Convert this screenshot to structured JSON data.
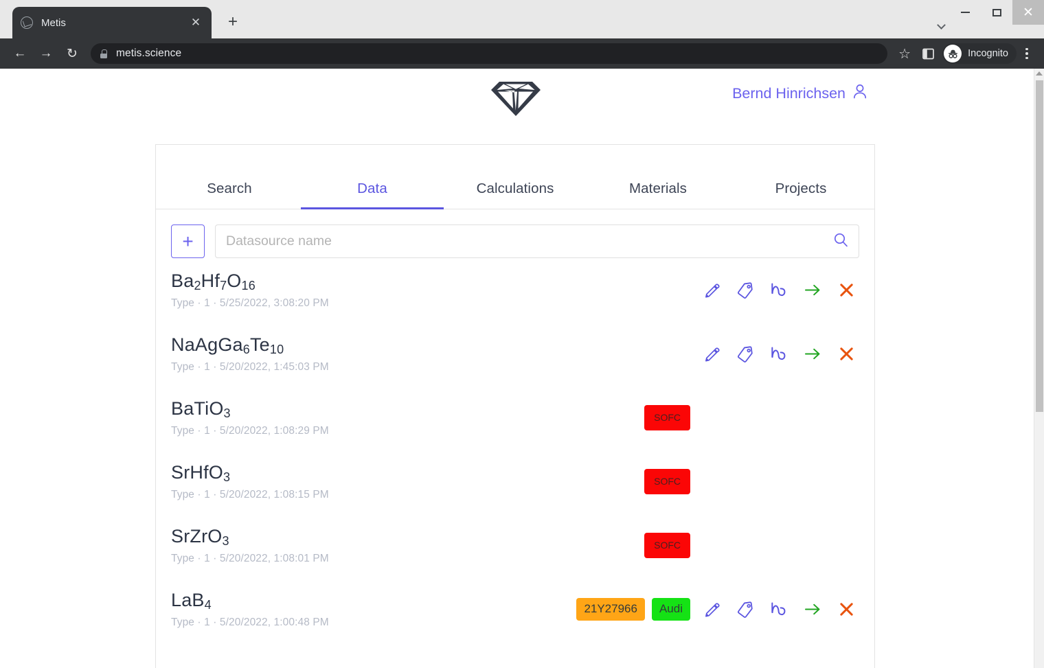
{
  "browser": {
    "tab_title": "Metis",
    "tab_close_glyph": "✕",
    "newtab_glyph": "+",
    "back_glyph": "←",
    "forward_glyph": "→",
    "reload_glyph": "↻",
    "url": "metis.science",
    "star_glyph": "☆",
    "incognito_label": "Incognito",
    "window_close_glyph": "✕"
  },
  "header": {
    "logo_name": "diamond-logo",
    "user_name": "Bernd Hinrichsen"
  },
  "tabs": [
    {
      "label": "Search",
      "active": false
    },
    {
      "label": "Data",
      "active": true
    },
    {
      "label": "Calculations",
      "active": false
    },
    {
      "label": "Materials",
      "active": false
    },
    {
      "label": "Projects",
      "active": false
    }
  ],
  "toolbar": {
    "add_label": "+",
    "search_placeholder": "Datasource name",
    "search_value": ""
  },
  "colors": {
    "accent": "#5b55e0",
    "user_link": "#6b62ee",
    "icon_edit": "#5b55e0",
    "icon_tag": "#5b55e0",
    "icon_plot": "#5b55e0",
    "icon_arrow": "#22a522",
    "icon_delete": "#e8530e",
    "tag_red": "#fb0606",
    "tag_orange": "#ffa516",
    "tag_green": "#15e215"
  },
  "rows": [
    {
      "formula_parts": [
        {
          "t": "Ba",
          "sub": false
        },
        {
          "t": "2",
          "sub": true
        },
        {
          "t": "Hf",
          "sub": false
        },
        {
          "t": "7",
          "sub": true
        },
        {
          "t": "O",
          "sub": false
        },
        {
          "t": "16",
          "sub": true
        }
      ],
      "formula_text": "Ba2Hf7O16",
      "meta": "Type · 1 · 5/25/2022, 3:08:20 PM",
      "tags": [],
      "actions": [
        "edit",
        "tag",
        "plot",
        "move",
        "delete"
      ]
    },
    {
      "formula_parts": [
        {
          "t": "NaAgGa",
          "sub": false
        },
        {
          "t": "6",
          "sub": true
        },
        {
          "t": "Te",
          "sub": false
        },
        {
          "t": "10",
          "sub": true
        }
      ],
      "formula_text": "NaAgGa6Te10",
      "meta": "Type · 1 · 5/20/2022, 1:45:03 PM",
      "tags": [],
      "actions": [
        "edit",
        "tag",
        "plot",
        "move",
        "delete"
      ]
    },
    {
      "formula_parts": [
        {
          "t": "BaTiO",
          "sub": false
        },
        {
          "t": "3",
          "sub": true
        }
      ],
      "formula_text": "BaTiO3",
      "meta": "Type · 1 · 5/20/2022, 1:08:29 PM",
      "tags": [
        {
          "label": "SOFC",
          "color": "#fb0606",
          "kind": "sofc"
        }
      ],
      "actions": []
    },
    {
      "formula_parts": [
        {
          "t": "SrHfO",
          "sub": false
        },
        {
          "t": "3",
          "sub": true
        }
      ],
      "formula_text": "SrHfO3",
      "meta": "Type · 1 · 5/20/2022, 1:08:15 PM",
      "tags": [
        {
          "label": "SOFC",
          "color": "#fb0606",
          "kind": "sofc"
        }
      ],
      "actions": []
    },
    {
      "formula_parts": [
        {
          "t": "SrZrO",
          "sub": false
        },
        {
          "t": "3",
          "sub": true
        }
      ],
      "formula_text": "SrZrO3",
      "meta": "Type · 1 · 5/20/2022, 1:08:01 PM",
      "tags": [
        {
          "label": "SOFC",
          "color": "#fb0606",
          "kind": "sofc"
        }
      ],
      "actions": []
    },
    {
      "formula_parts": [
        {
          "t": "LaB",
          "sub": false
        },
        {
          "t": "4",
          "sub": true
        }
      ],
      "formula_text": "LaB4",
      "meta": "Type · 1 · 5/20/2022, 1:00:48 PM",
      "tags": [
        {
          "label": "21Y27966",
          "color": "#ffa516",
          "kind": "plain"
        },
        {
          "label": "Audi",
          "color": "#15e215",
          "kind": "plain"
        }
      ],
      "actions": [
        "edit",
        "tag",
        "plot",
        "move",
        "delete"
      ]
    }
  ]
}
